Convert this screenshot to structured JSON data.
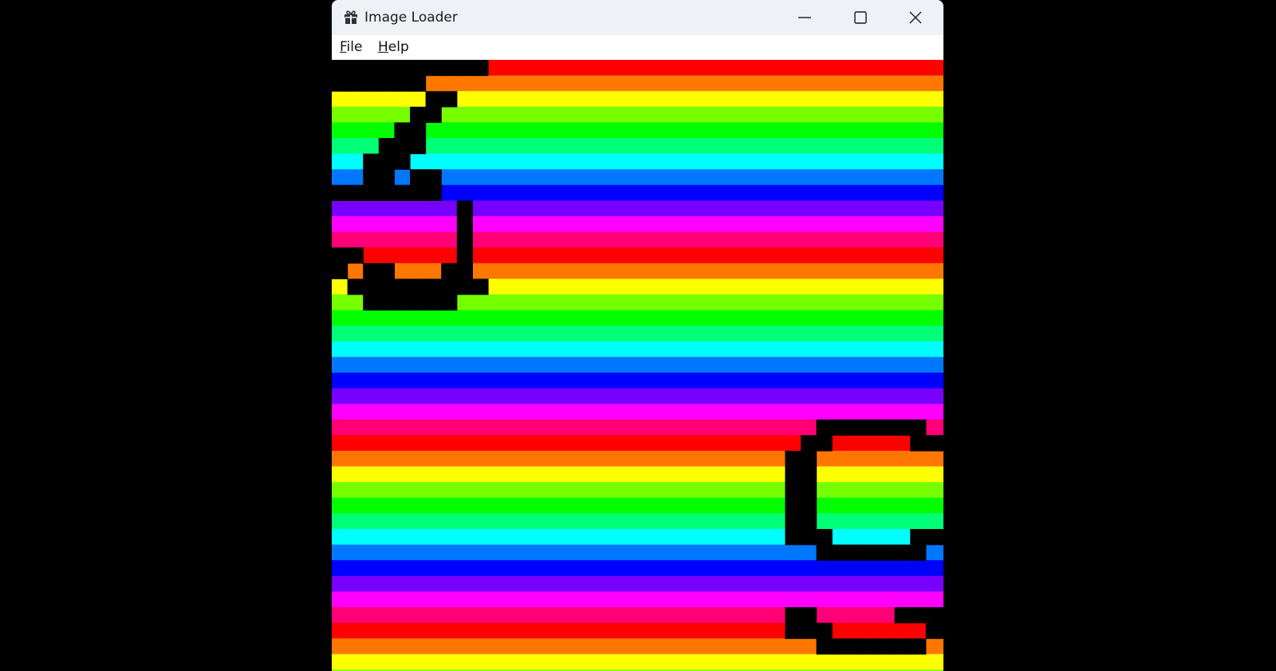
{
  "window": {
    "title": "Image Loader",
    "app_icon": "gift-box-icon",
    "controls": {
      "minimize_icon": "minimize-icon",
      "maximize_icon": "maximize-icon",
      "close_icon": "close-icon"
    }
  },
  "menu": {
    "items": [
      {
        "mnemonic": "F",
        "rest": "ile"
      },
      {
        "mnemonic": "H",
        "rest": "elp"
      }
    ]
  },
  "image": {
    "description_icon": "rainbow-stripes-image",
    "glyphs": [
      "6",
      "9"
    ],
    "stripe_colors": [
      "#ff0000",
      "#ff7700",
      "#ffff00",
      "#77ff00",
      "#00ff00",
      "#00ff77",
      "#00ffff",
      "#0077ff",
      "#0000ff",
      "#7700ff",
      "#ff00ff",
      "#ff0077"
    ]
  }
}
